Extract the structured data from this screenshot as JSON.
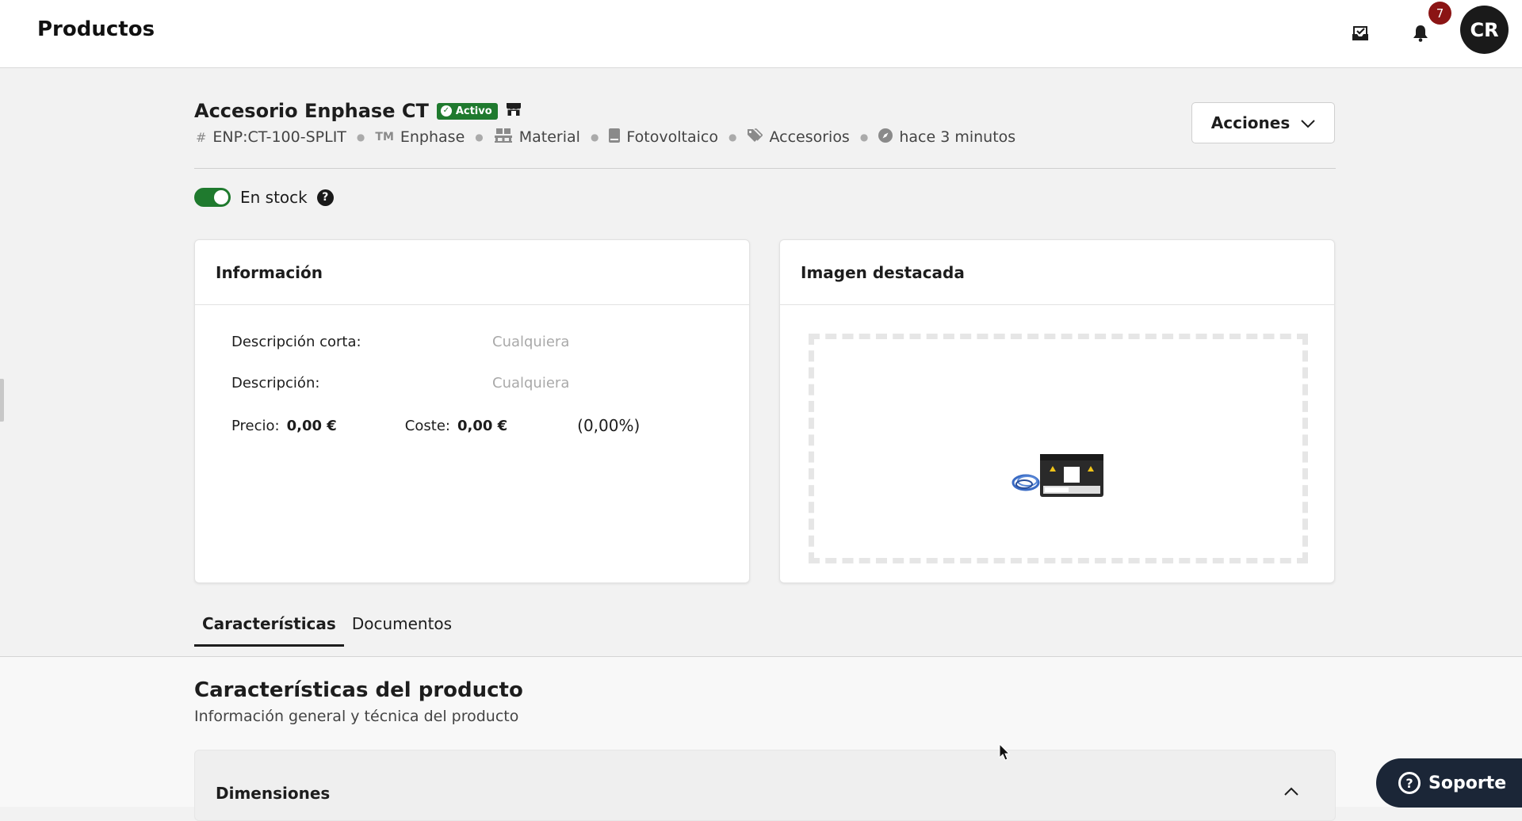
{
  "header": {
    "title": "Productos",
    "notifications_count": "7",
    "avatar_initials": "CR"
  },
  "product": {
    "name": "Accesorio Enphase CT",
    "status": "Activo",
    "meta": {
      "sku": "ENP:CT-100-SPLIT",
      "brand": "Enphase",
      "type": "Material",
      "category": "Fotovoltaico",
      "subcategory": "Accesorios",
      "updated": "hace 3 minutos"
    },
    "actions_label": "Acciones",
    "stock_label": "En stock",
    "stock_enabled": true
  },
  "info_card": {
    "title": "Información",
    "short_desc_label": "Descripción corta:",
    "short_desc_value": "Cualquiera",
    "desc_label": "Descripción:",
    "desc_value": "Cualquiera",
    "price_label": "Precio:",
    "price_value": "0,00 €",
    "cost_label": "Coste:",
    "cost_value": "0,00 €",
    "margin": "(0,00%)"
  },
  "image_card": {
    "title": "Imagen destacada"
  },
  "tabs": [
    {
      "label": "Características",
      "active": true
    },
    {
      "label": "Documentos",
      "active": false
    }
  ],
  "section": {
    "title": "Características del producto",
    "subtitle": "Información general y técnica del producto"
  },
  "dimensions": {
    "title": "Dimensiones"
  },
  "support": {
    "label": "Soporte"
  },
  "colors": {
    "accent_green": "#1f7a2e",
    "badge_red": "#8b1414",
    "support_navy": "#1b2637"
  }
}
